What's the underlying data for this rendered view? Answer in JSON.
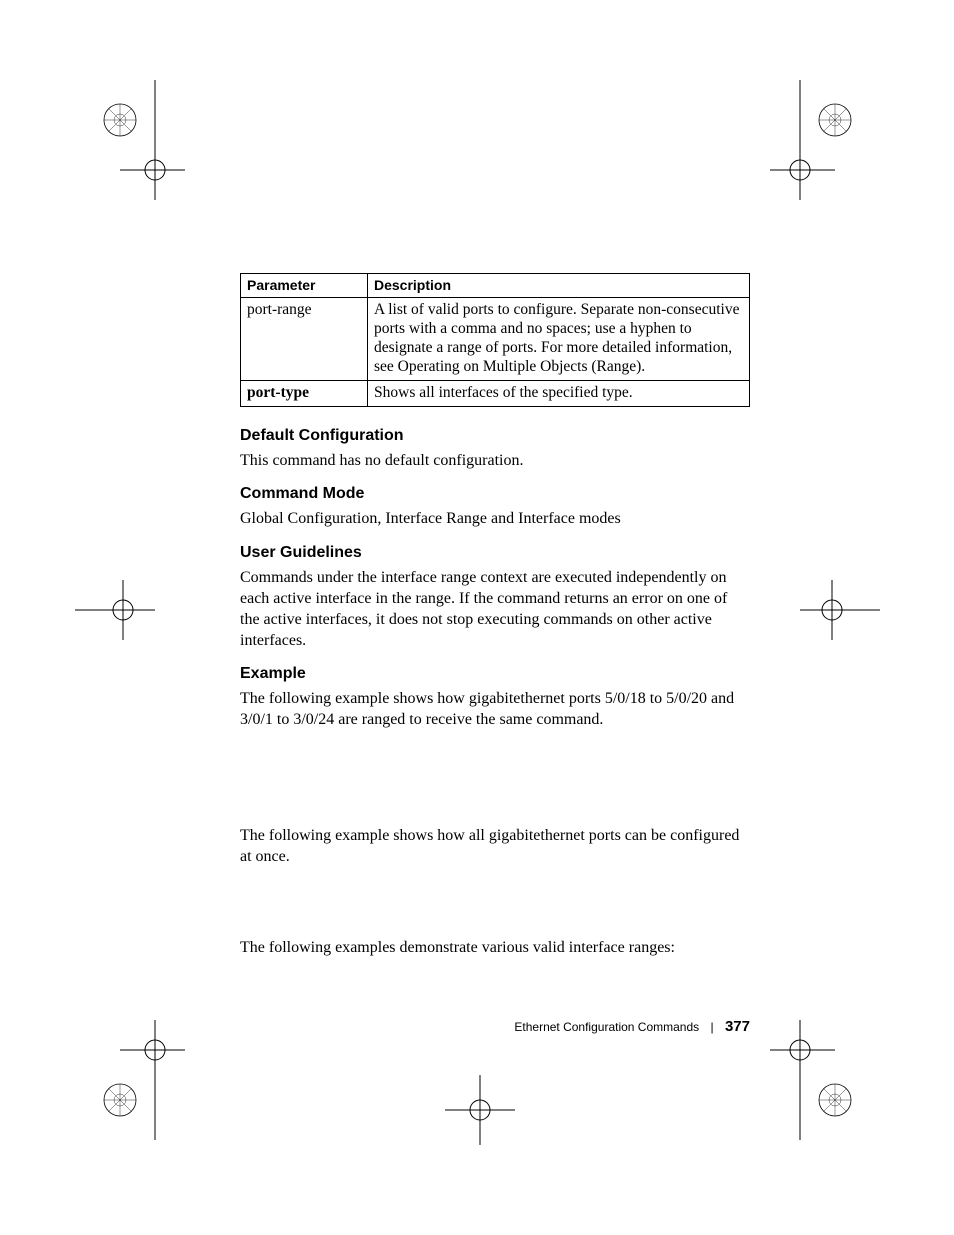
{
  "table": {
    "headers": {
      "parameter": "Parameter",
      "description": "Description"
    },
    "rows": [
      {
        "param": "port-range",
        "param_bold": false,
        "desc": "A list of valid ports to configure. Separate non-consecutive ports with a comma and no spaces; use a hyphen to designate a range of ports. For more detailed information, see Operating on Multiple Objects (Range)."
      },
      {
        "param": "port-type",
        "param_bold": true,
        "desc": "Shows all interfaces of the specified type."
      }
    ]
  },
  "sections": {
    "default_config": {
      "heading": "Default Configuration",
      "body": "This command has no default configuration."
    },
    "command_mode": {
      "heading": "Command Mode",
      "body": "Global Configuration, Interface Range and Interface modes"
    },
    "user_guidelines": {
      "heading": "User Guidelines",
      "body": "Commands under the interface range context are executed independently on each active interface in the range. If the command returns an error on one of the active interfaces, it does not stop executing commands on other active interfaces."
    },
    "example": {
      "heading": "Example",
      "body1": "The following example shows how gigabitethernet  ports 5/0/18 to 5/0/20 and 3/0/1 to 3/0/24 are ranged to receive the same command.",
      "body2": "The following example shows how all gigabitethernet ports can be configured at once.",
      "body3": "The following examples demonstrate various valid interface ranges:"
    }
  },
  "footer": {
    "chapter": "Ethernet Configuration Commands",
    "page": "377"
  }
}
